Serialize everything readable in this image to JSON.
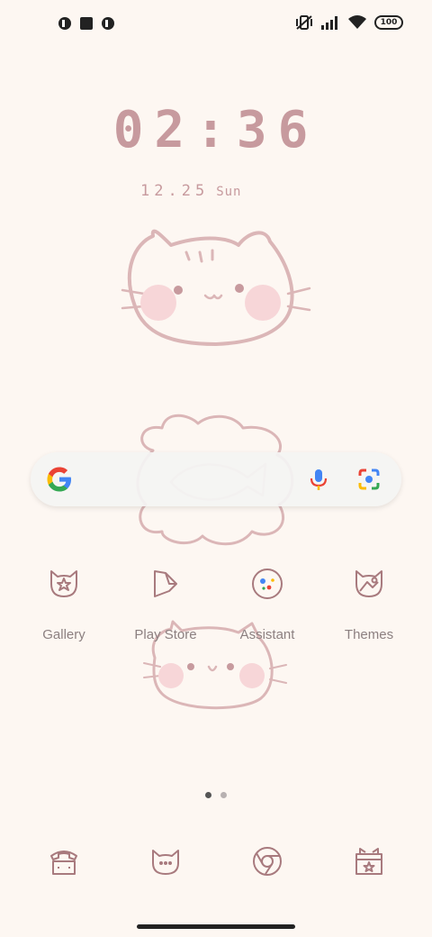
{
  "status_bar": {
    "left_icons": [
      "app-notification-icon",
      "square-notification-icon",
      "app-notification-icon"
    ],
    "right_icons": [
      "vibrate-off-icon",
      "signal-icon",
      "wifi-icon"
    ],
    "battery": "100"
  },
  "clock": {
    "time": "02:36",
    "date": "12.25",
    "day": "Sun"
  },
  "search_bar": {
    "left_icon": "google-g-icon",
    "mic_icon": "microphone-icon",
    "lens_icon": "lens-camera-icon"
  },
  "apps": [
    {
      "label": "Gallery",
      "icon": "cat-star-icon"
    },
    {
      "label": "Play Store",
      "icon": "play-store-icon"
    },
    {
      "label": "Assistant",
      "icon": "assistant-icon"
    },
    {
      "label": "Themes",
      "icon": "cat-theme-icon"
    }
  ],
  "page_indicator": {
    "pages": 2,
    "current": 1
  },
  "dock": [
    {
      "icon": "phone-icon"
    },
    {
      "icon": "messages-cat-icon"
    },
    {
      "icon": "chrome-icon"
    },
    {
      "icon": "app-store-icon"
    }
  ],
  "colors": {
    "background": "#fdf7f2",
    "accent": "#c79a9e",
    "icon_stroke": "#a87a7e"
  }
}
